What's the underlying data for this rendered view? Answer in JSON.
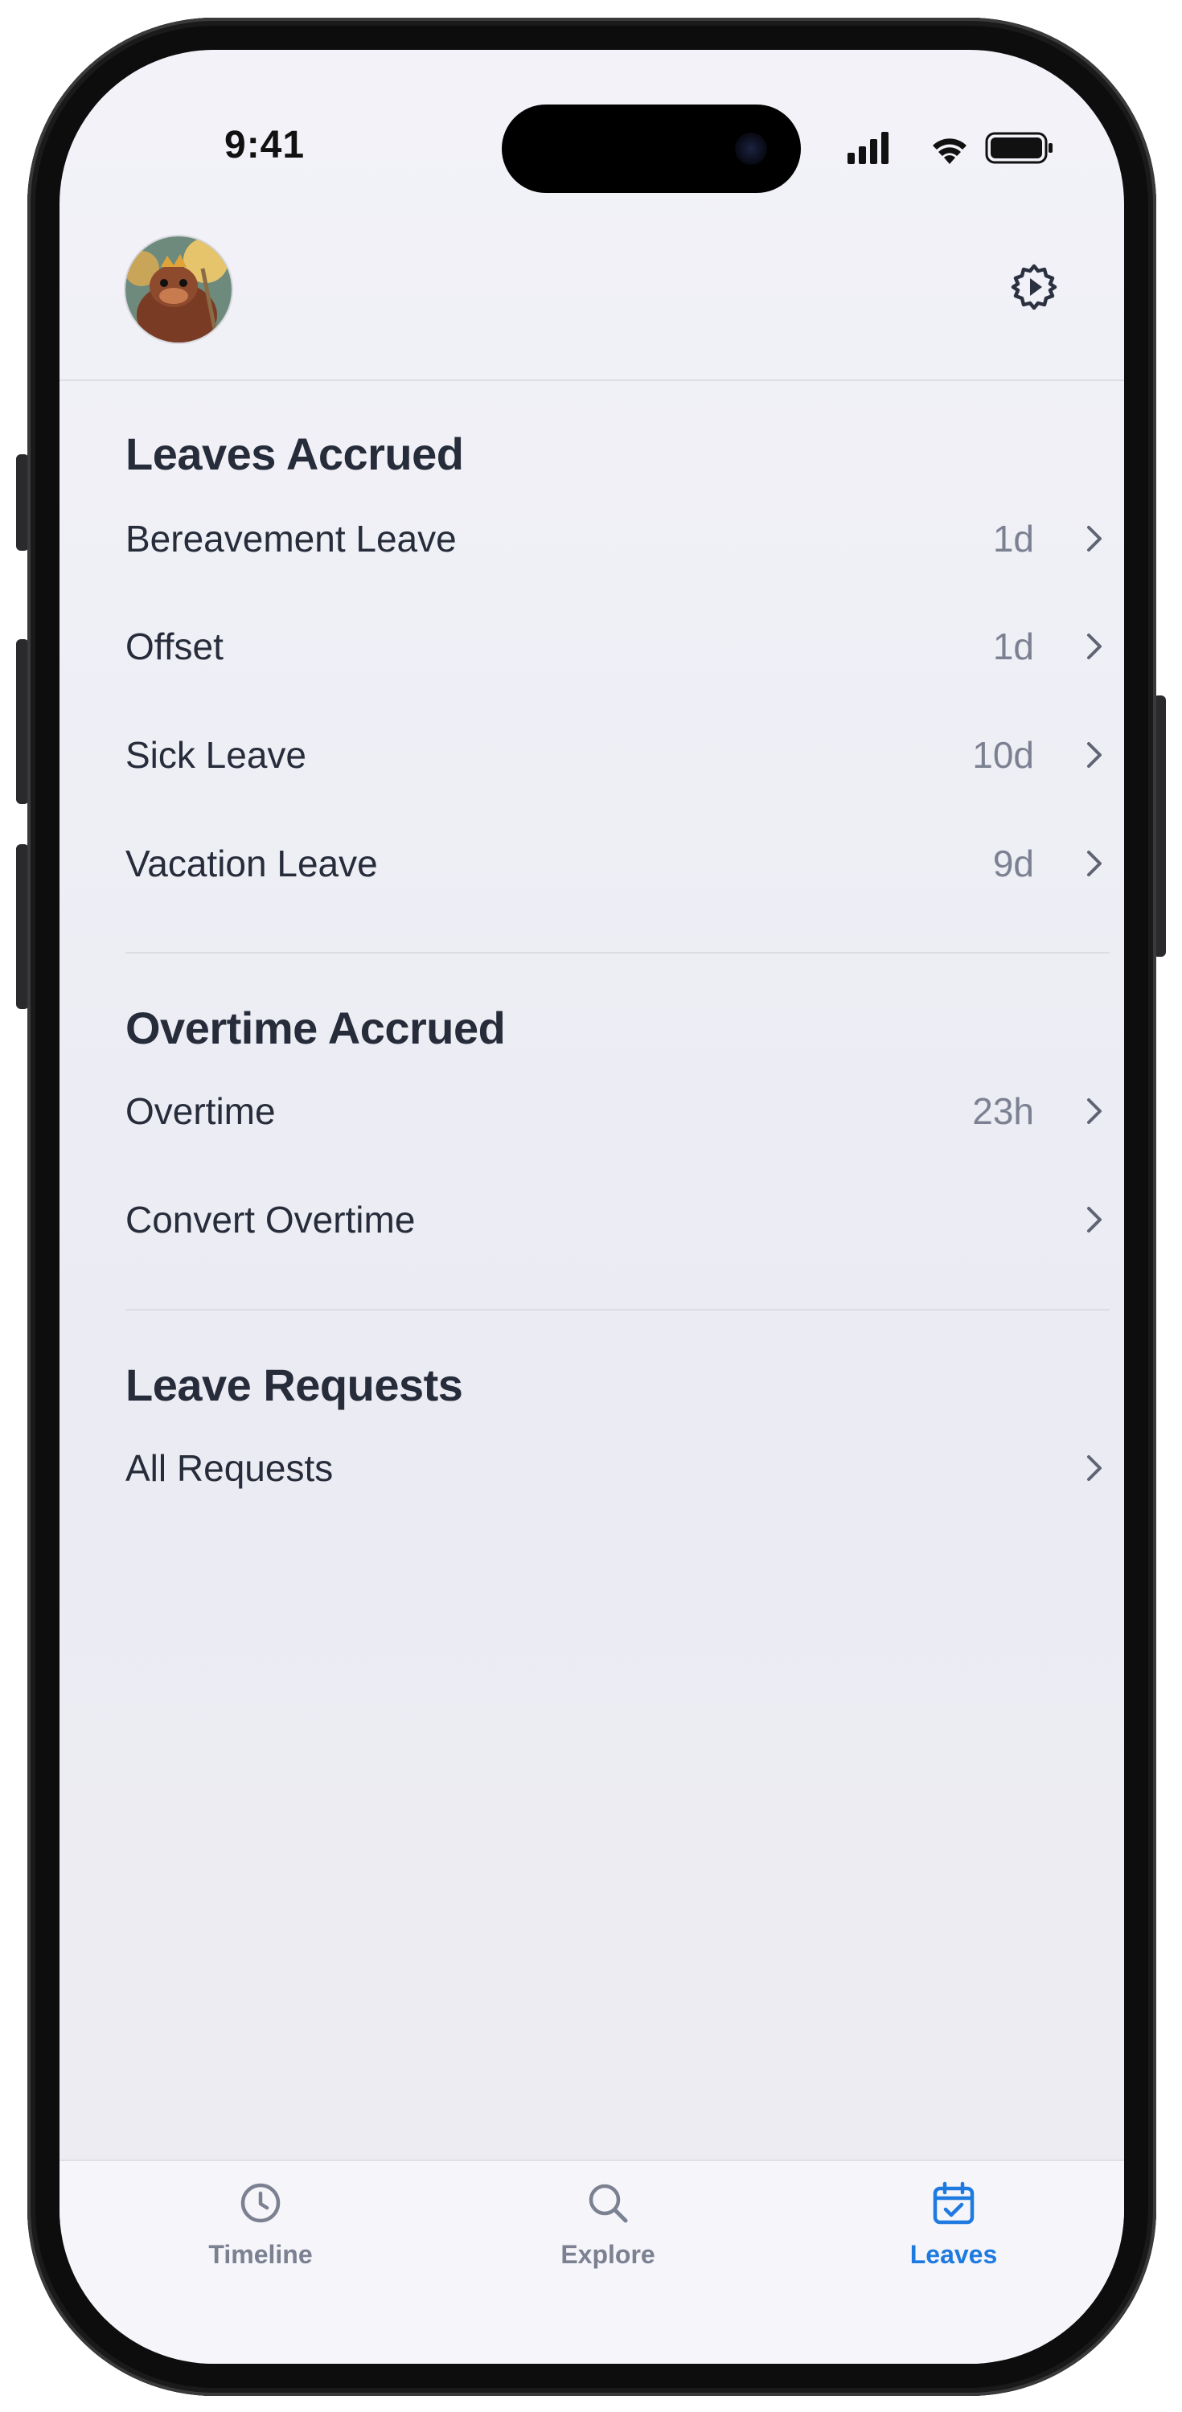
{
  "status_bar": {
    "time": "9:41"
  },
  "header": {
    "avatar_icon": "avatar",
    "settings_icon": "gear-icon"
  },
  "sections": {
    "leaves_accrued": {
      "title": "Leaves Accrued",
      "items": [
        {
          "label": "Bereavement Leave",
          "value": "1d"
        },
        {
          "label": "Offset",
          "value": "1d"
        },
        {
          "label": "Sick Leave",
          "value": "10d"
        },
        {
          "label": "Vacation Leave",
          "value": "9d"
        }
      ]
    },
    "overtime_accrued": {
      "title": "Overtime Accrued",
      "items": [
        {
          "label": "Overtime",
          "value": "23h"
        },
        {
          "label": "Convert Overtime",
          "value": ""
        }
      ]
    },
    "leave_requests": {
      "title": "Leave Requests",
      "items": [
        {
          "label": "All Requests",
          "value": ""
        }
      ]
    }
  },
  "tabbar": {
    "tabs": [
      {
        "label": "Timeline",
        "icon": "clock-icon",
        "active": false
      },
      {
        "label": "Explore",
        "icon": "search-icon",
        "active": false
      },
      {
        "label": "Leaves",
        "icon": "calendar-check-icon",
        "active": true
      }
    ]
  },
  "colors": {
    "accent": "#1f7ae0",
    "text_primary": "#262c3a",
    "text_secondary": "#7c8192",
    "background": "#f2f2f8"
  }
}
